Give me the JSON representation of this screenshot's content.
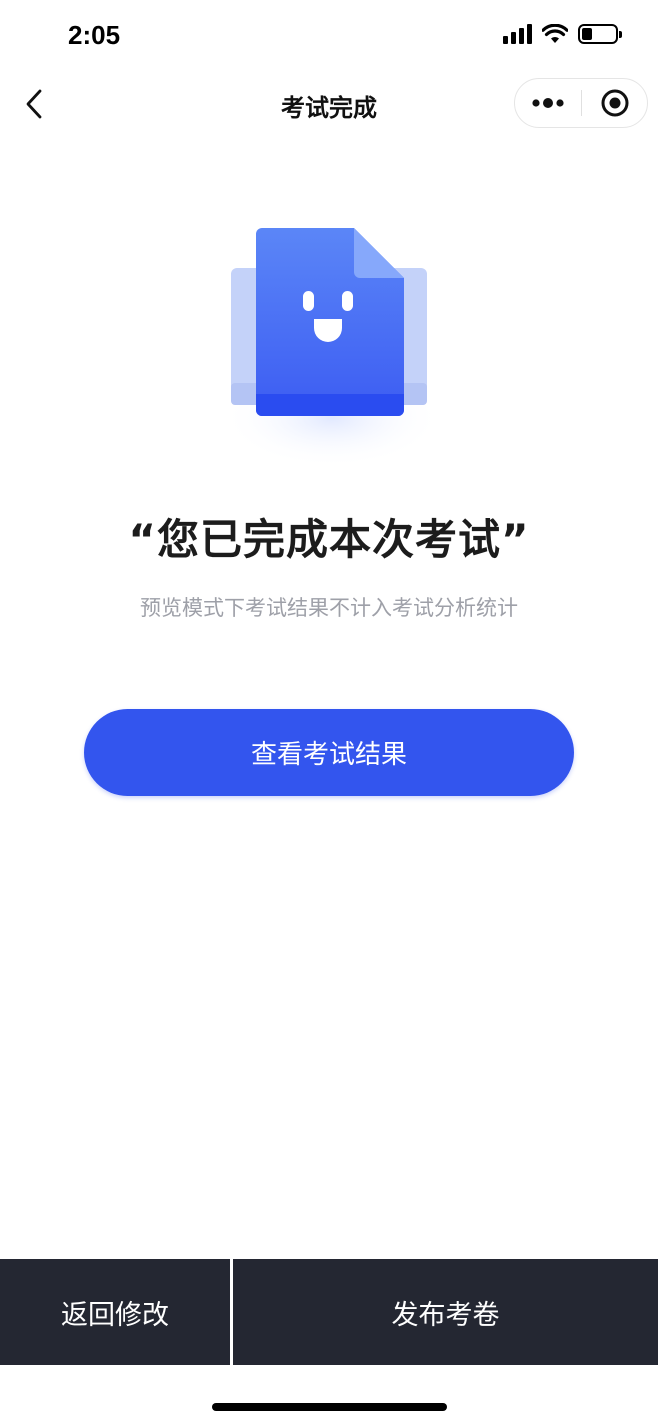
{
  "status_bar": {
    "time": "2:05",
    "battery_level": 0.3
  },
  "nav": {
    "title": "考试完成",
    "back_icon": "chevron-left-icon",
    "more_icon": "more-dots-icon",
    "close_icon": "target-circle-icon"
  },
  "main": {
    "title": "“您已完成本次考试”",
    "subtitle": "预览模式下考试结果不计入考试分析统计",
    "view_result_label": "查看考试结果",
    "illustration_icon": "smiling-document-icon"
  },
  "bottom_bar": {
    "back_edit_label": "返回修改",
    "publish_label": "发布考卷"
  },
  "colors": {
    "accent": "#3355ee",
    "bottom_bar": "#242732",
    "subtitle": "#9ea0a8"
  }
}
